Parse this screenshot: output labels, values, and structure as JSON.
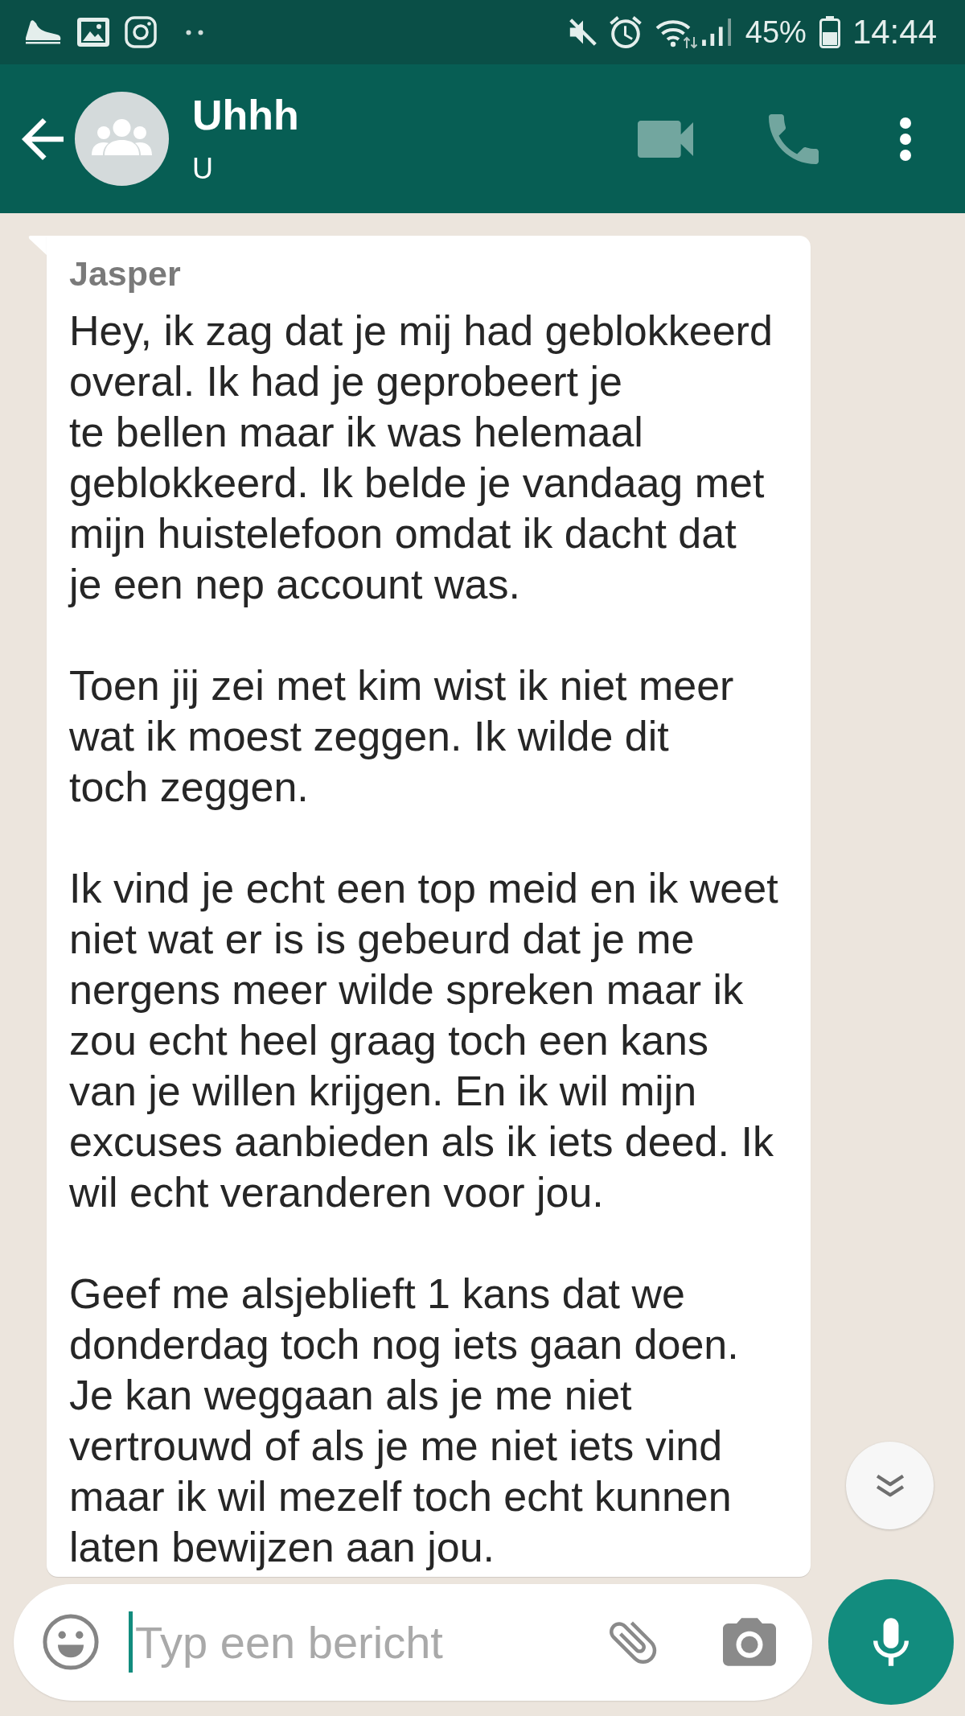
{
  "status_bar": {
    "battery": "45%",
    "time": "14:44"
  },
  "header": {
    "title": "Uhhh",
    "subtitle": "U"
  },
  "message": {
    "sender": "Jasper",
    "paragraphs": [
      {
        "lines": [
          "Hey, ik zag dat je mij had geblokkeerd",
          "overal. Ik had je geprobeert je",
          "te bellen maar ik was helemaal",
          "geblokkeerd. Ik belde je vandaag met",
          "mijn huistelefoon omdat ik dacht dat",
          "je een nep account was."
        ]
      },
      {
        "lines": [
          "Toen jij zei met kim wist ik niet meer",
          "wat ik moest zeggen. Ik wilde dit",
          "toch zeggen."
        ]
      },
      {
        "lines": [
          "Ik vind je echt een top meid en ik weet",
          "niet wat er is is gebeurd dat je me",
          "nergens meer wilde spreken maar ik",
          "zou echt heel graag toch een kans",
          "van je willen krijgen. En ik wil mijn",
          "excuses aanbieden als ik iets deed. Ik",
          "wil echt veranderen voor jou."
        ]
      },
      {
        "lines": [
          "Geef me alsjeblieft 1 kans dat we",
          "donderdag toch nog iets gaan doen.",
          "Je kan weggaan als je me niet",
          "vertrouwd of als je me niet iets vind",
          "maar ik wil mezelf toch echt kunnen",
          "laten bewijzen aan jou."
        ]
      }
    ]
  },
  "composer": {
    "placeholder": "Typ een bericht"
  }
}
